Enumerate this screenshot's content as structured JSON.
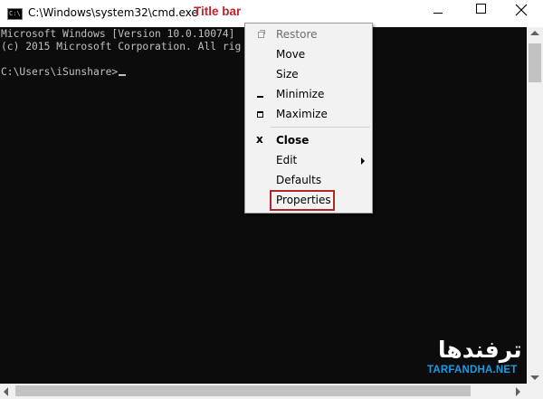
{
  "window": {
    "title": "C:\\Windows\\system32\\cmd.exe",
    "icon_text": "C:\\",
    "annotation": "Title bar",
    "annotation_color": "#c42327",
    "controls": {
      "minimize": "minimize-icon",
      "maximize": "maximize-icon",
      "close": "close-icon"
    }
  },
  "console": {
    "lines": [
      "Microsoft Windows [Version 10.0.10074]",
      "(c) 2015 Microsoft Corporation. All rig"
    ],
    "prompt": "C:\\Users\\iSunshare>",
    "background": "#0c0c0c",
    "foreground": "#c0c0c0"
  },
  "system_menu": {
    "items": [
      {
        "label": "Restore",
        "icon": "restore-icon",
        "disabled": true
      },
      {
        "label": "Move"
      },
      {
        "label": "Size"
      },
      {
        "label": "Minimize",
        "icon": "minimize-icon"
      },
      {
        "label": "Maximize",
        "icon": "maximize-icon"
      },
      {
        "label": "Close",
        "icon": "close-icon",
        "bold": true,
        "icon_glyph": "x"
      },
      {
        "label": "Edit",
        "has_submenu": true
      },
      {
        "label": "Defaults"
      },
      {
        "label": "Properties",
        "highlighted": true
      }
    ],
    "highlight_color": "#b3262b"
  },
  "watermark": {
    "logo": "ترفندها",
    "site": "TARFANDHA.NET",
    "site_color": "#1a9be0"
  }
}
